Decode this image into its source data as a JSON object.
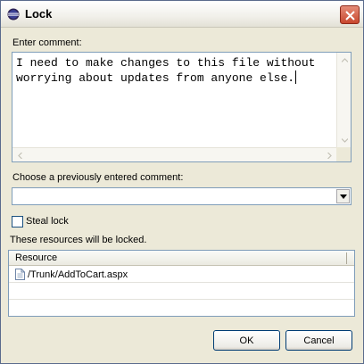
{
  "window": {
    "title": "Lock",
    "close_icon": "close-icon",
    "app_icon": "eclipse-icon"
  },
  "comment": {
    "label": "Enter comment:",
    "text": "I need to make changes to this file without worrying about updates from anyone else."
  },
  "previous_comment": {
    "label": "Choose a previously entered comment:",
    "selected": ""
  },
  "steal_lock": {
    "label": "Steal lock",
    "checked": false
  },
  "resources": {
    "label": "These resources will be locked.",
    "columns": [
      "Resource"
    ],
    "rows": [
      {
        "name": "/Trunk/AddToCart.aspx",
        "icon": "file-icon"
      }
    ]
  },
  "buttons": {
    "ok": "OK",
    "cancel": "Cancel"
  },
  "colors": {
    "field_border": "#7f9db9",
    "dialog_bg": "#ece9d8",
    "close_red": "#c8472e"
  }
}
